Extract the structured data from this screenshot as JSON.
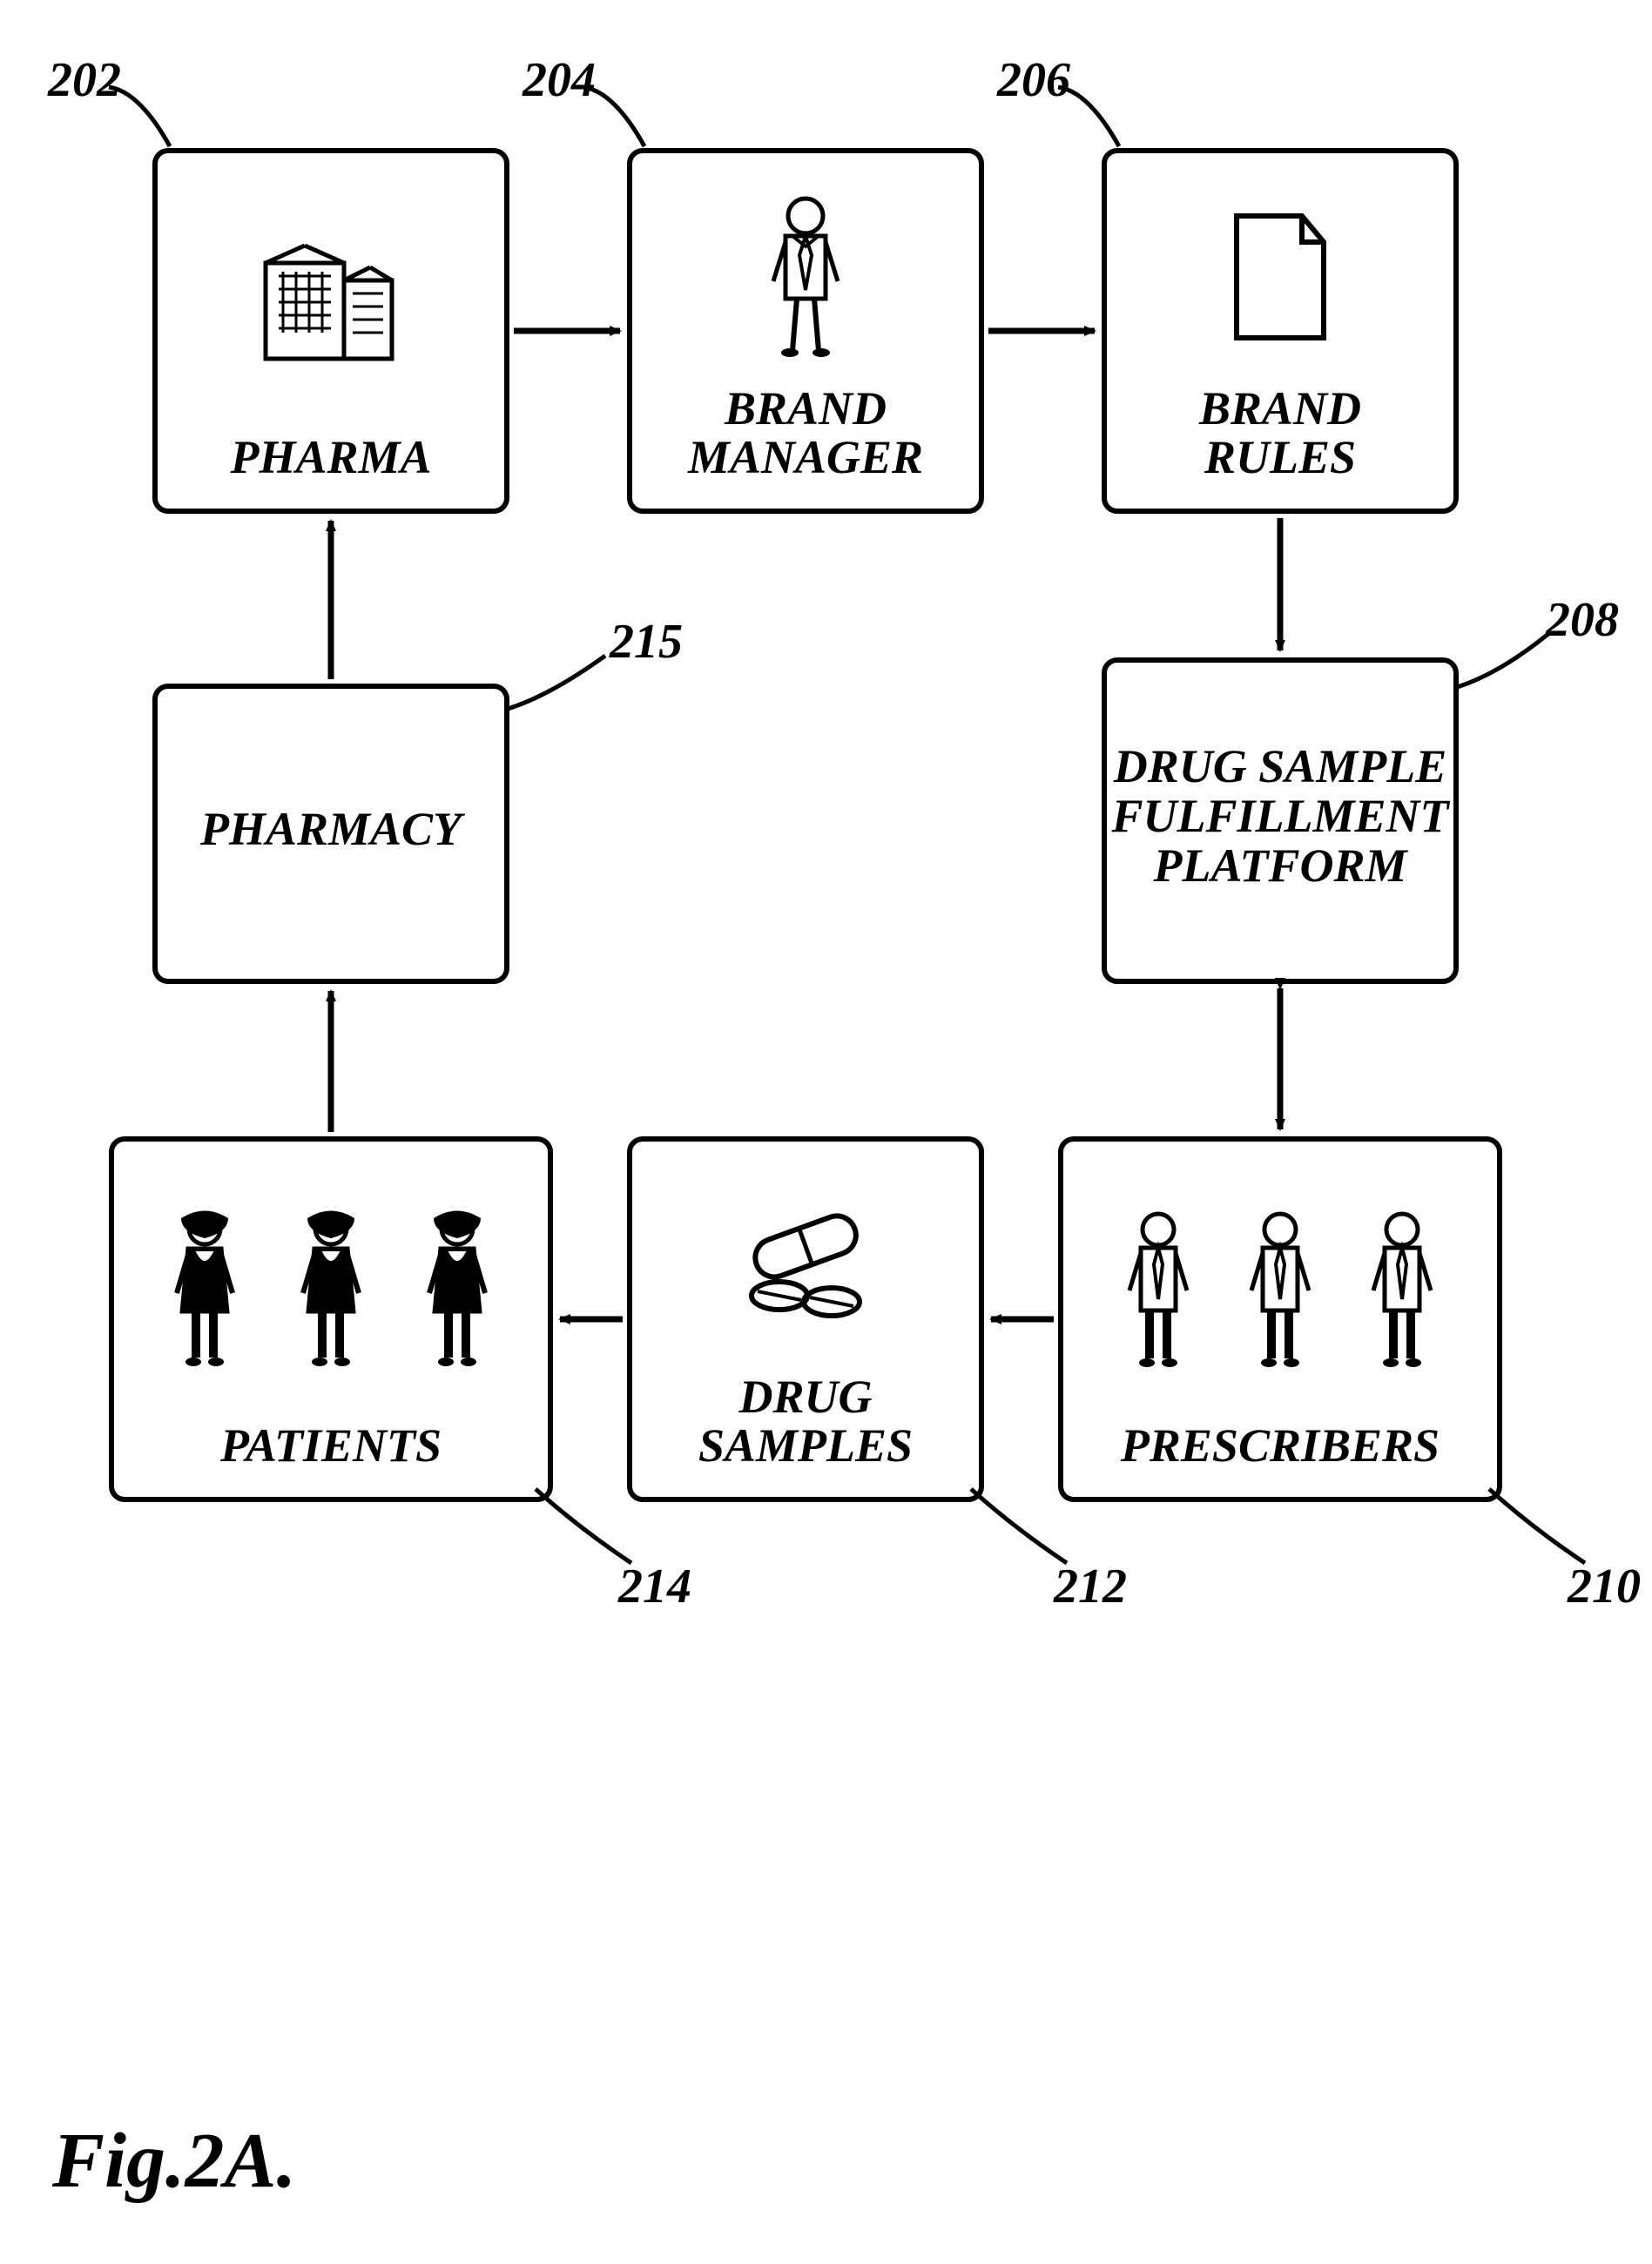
{
  "nodes": {
    "pharma": {
      "label": "PHARMA",
      "ref": "202"
    },
    "brand_mgr": {
      "label": "BRAND\nMANAGER",
      "ref": "204"
    },
    "brand_rules": {
      "label": "BRAND\nRULES",
      "ref": "206"
    },
    "platform": {
      "label": "DRUG SAMPLE\nFULFILLMENT\nPLATFORM",
      "ref": "208"
    },
    "prescribers": {
      "label": "PRESCRIBERS",
      "ref": "210"
    },
    "drug_samples": {
      "label": "DRUG\nSAMPLES",
      "ref": "212"
    },
    "patients": {
      "label": "PATIENTS",
      "ref": "214"
    },
    "pharmacy": {
      "label": "PHARMACY",
      "ref": "215"
    }
  },
  "figure": "Fig.2A."
}
